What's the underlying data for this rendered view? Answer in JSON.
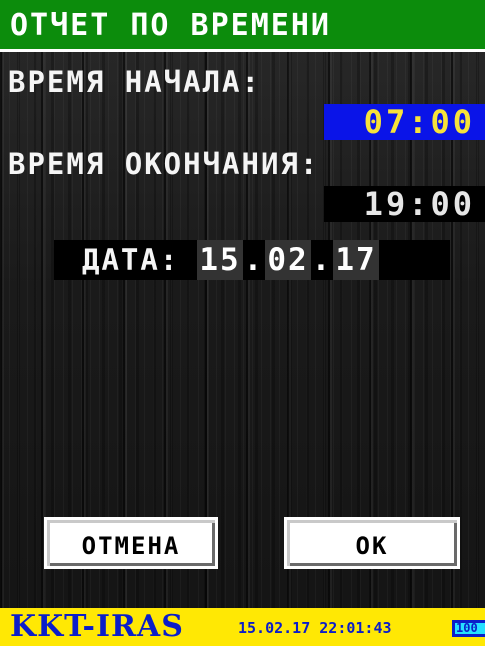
{
  "header": {
    "title": "ОТЧЕТ ПО ВРЕМЕНИ"
  },
  "form": {
    "start_label": "ВРЕМЯ НАЧАЛА:",
    "start_time": "07:00",
    "end_label": "ВРЕМЯ ОКОНЧАНИЯ:",
    "end_time": "19:00",
    "date_label": "ДАТА:",
    "date_day": "15",
    "date_month": "02",
    "date_year": "17",
    "date_separator": "."
  },
  "buttons": {
    "cancel_label": "ОТМЕНА",
    "ok_label": "ОК"
  },
  "status_bar": {
    "brand": "KKT-IRAS",
    "datetime": "15.02.17 22:01:43",
    "battery_label": "100",
    "battery_level_percent": 100
  },
  "colors": {
    "title_bg": "#0c8c0c",
    "selected_field_bg": "#0a14e8",
    "selected_field_text": "#f7e23a",
    "status_bar_bg": "#ffe804",
    "status_bar_text": "#0b1ec9",
    "battery_fill": "#26e0ff"
  }
}
